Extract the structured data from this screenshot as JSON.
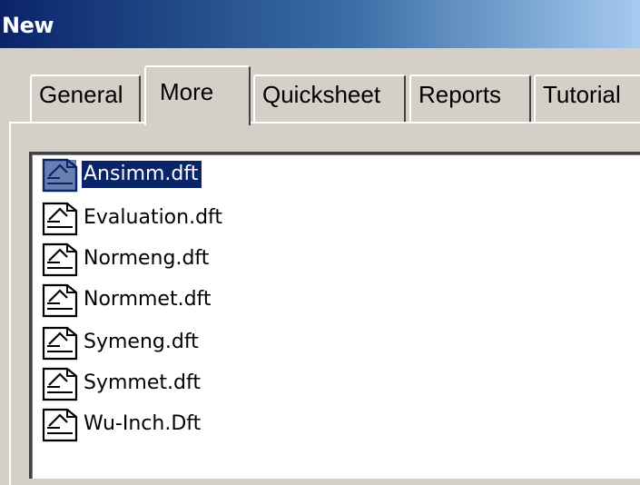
{
  "window": {
    "title": "New"
  },
  "tabs": [
    {
      "label": "General"
    },
    {
      "label": "More",
      "selected": true
    },
    {
      "label": "Quicksheet"
    },
    {
      "label": "Reports"
    },
    {
      "label": "Tutorial"
    }
  ],
  "files": [
    {
      "name": "Ansimm.dft",
      "icon": "template-file-icon",
      "selected": true
    },
    {
      "name": "Evaluation.dft",
      "icon": "template-file-icon"
    },
    {
      "name": "Normeng.dft",
      "icon": "template-file-icon"
    },
    {
      "name": "Normmet.dft",
      "icon": "template-file-icon"
    },
    {
      "name": "Symeng.dft",
      "icon": "template-file-icon"
    },
    {
      "name": "Symmet.dft",
      "icon": "template-file-icon"
    },
    {
      "name": "Wu-Inch.Dft",
      "icon": "template-file-icon"
    }
  ],
  "colors": {
    "title_bar_start": "#0a246a",
    "title_bar_end": "#a6caf0",
    "selection_background": "#0a246a",
    "dialog_face": "#d4d0c8"
  }
}
